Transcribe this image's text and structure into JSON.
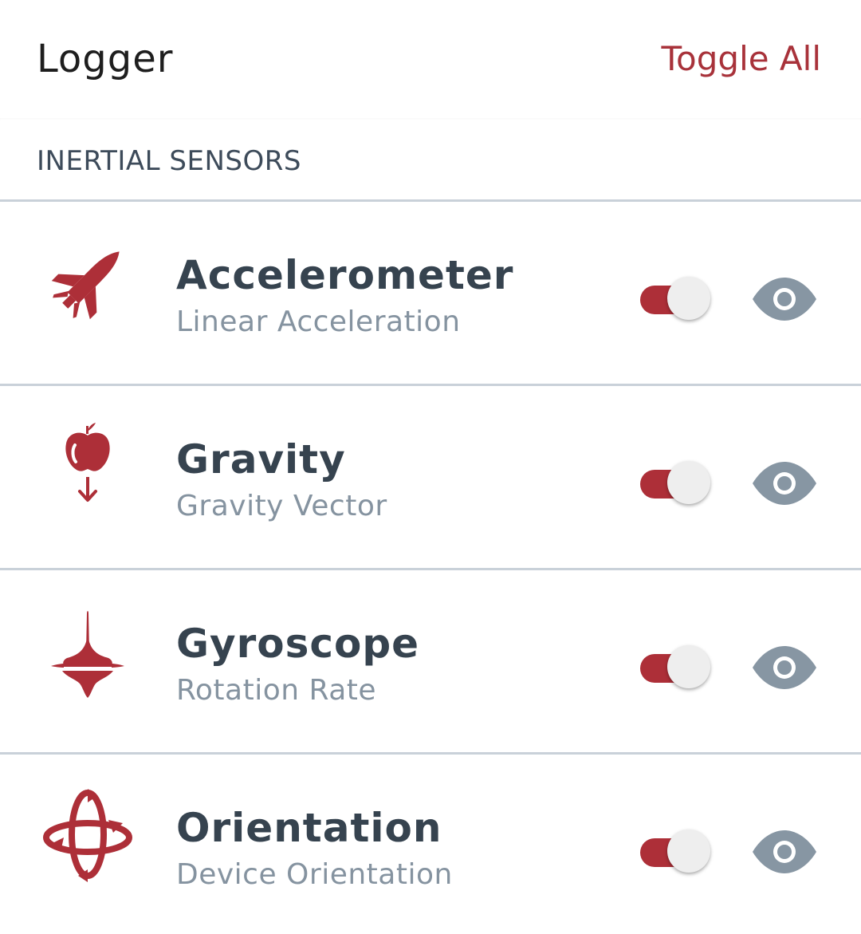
{
  "header": {
    "title": "Logger",
    "toggle_all_label": "Toggle All"
  },
  "section": {
    "label": "INERTIAL SENSORS"
  },
  "colors": {
    "accent": "#ad2f38",
    "title_text": "#36434f",
    "subtitle_text": "#8593a0",
    "eye_icon": "#8796a3",
    "toggle_thumb": "#eeeeee"
  },
  "sensors": [
    {
      "title": "Accelerometer",
      "subtitle": "Linear Acceleration",
      "icon": "rocket-icon",
      "enabled": true
    },
    {
      "title": "Gravity",
      "subtitle": "Gravity Vector",
      "icon": "apple-gravity-icon",
      "enabled": true
    },
    {
      "title": "Gyroscope",
      "subtitle": "Rotation Rate",
      "icon": "spinning-top-icon",
      "enabled": true
    },
    {
      "title": "Orientation",
      "subtitle": "Device Orientation",
      "icon": "rotation-icon",
      "enabled": true
    }
  ]
}
